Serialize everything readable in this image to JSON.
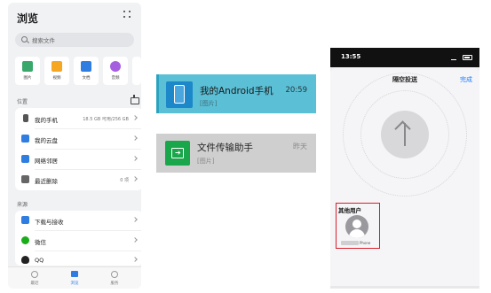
{
  "browse": {
    "title": "浏览",
    "search_placeholder": "搜索文件",
    "categories": [
      {
        "label": "图片",
        "icon": "image-icon",
        "color": "#3aa86a"
      },
      {
        "label": "视频",
        "icon": "video-icon",
        "color": "#f5a623"
      },
      {
        "label": "文档",
        "icon": "document-icon",
        "color": "#2f7de1"
      },
      {
        "label": "音频",
        "icon": "audio-icon",
        "color": "#a55ee0"
      }
    ],
    "locations_label": "位置",
    "locations": [
      {
        "label": "我的手机",
        "value": "18.5 GB 可用/256 GB",
        "icon": "phone-icon",
        "color": "#555555"
      },
      {
        "label": "我的云盘",
        "value": "",
        "icon": "cloud-icon",
        "color": "#2f7de1"
      },
      {
        "label": "网络邻居",
        "value": "",
        "icon": "network-icon",
        "color": "#2f7de1"
      },
      {
        "label": "最近删除",
        "value": "0 项",
        "icon": "trash-icon",
        "color": "#666666"
      }
    ],
    "sources_label": "来源",
    "sources": [
      {
        "label": "下载与接收",
        "icon": "download-icon",
        "color": "#2f7de1"
      },
      {
        "label": "微信",
        "icon": "wechat-icon",
        "color": "#1aad19"
      },
      {
        "label": "QQ",
        "icon": "qq-icon",
        "color": "#222222"
      }
    ],
    "tabs": [
      {
        "label": "最近",
        "icon": "clock-icon",
        "color": "#9a9a9a"
      },
      {
        "label": "浏览",
        "icon": "folder-icon",
        "color": "#2f7de1"
      },
      {
        "label": "服务",
        "icon": "service-icon",
        "color": "#9a9a9a"
      }
    ]
  },
  "chats": [
    {
      "name": "我的Android手机",
      "subtitle": "[图片]",
      "time": "20:59",
      "icon": "android-phone-icon",
      "background": "#5bbfd6"
    },
    {
      "name": "文件传输助手",
      "subtitle": "[图片]",
      "time": "昨天",
      "icon": "file-transfer-icon",
      "background": "#cfcfcf"
    }
  ],
  "airdrop": {
    "status_time": "13:55",
    "title": "隔空投送",
    "done_label": "完成",
    "other_users_label": "其他用户",
    "user_name": "Phone",
    "accent": "#1a7cff",
    "highlight": "#d81e2a"
  }
}
